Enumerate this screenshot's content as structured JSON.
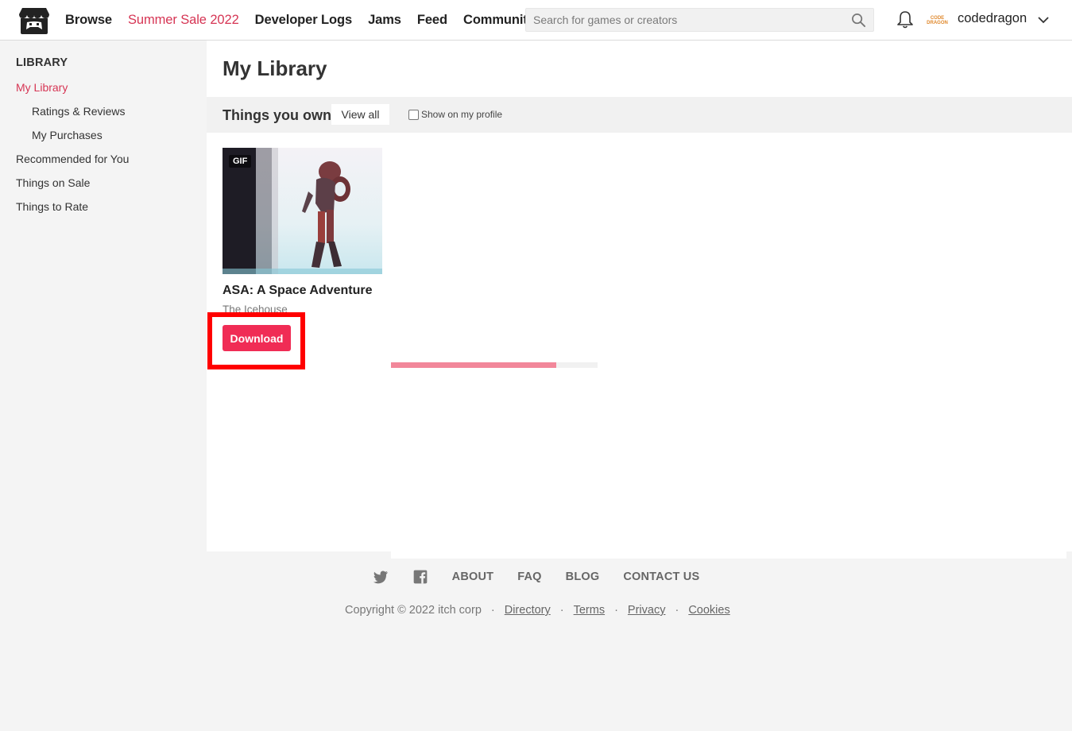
{
  "header": {
    "nav": [
      {
        "label": "Browse"
      },
      {
        "label": "Summer Sale 2022"
      },
      {
        "label": "Developer Logs"
      },
      {
        "label": "Jams"
      },
      {
        "label": "Feed"
      },
      {
        "label": "Community"
      }
    ],
    "search_placeholder": "Search for games or creators",
    "username": "codedragon",
    "avatar_text_top": "CODE",
    "avatar_text_bottom": "DRAGON",
    "accent_color": "#d63554"
  },
  "sidebar": {
    "heading": "LIBRARY",
    "items": [
      {
        "label": "My Library"
      },
      {
        "label": "Ratings & Reviews"
      },
      {
        "label": "My Purchases"
      },
      {
        "label": "Recommended for You"
      },
      {
        "label": "Things on Sale"
      },
      {
        "label": "Things to Rate"
      }
    ]
  },
  "main": {
    "title": "My Library",
    "section": {
      "title": "Things you own",
      "view_all": "View all",
      "show_on_profile": "Show on my profile"
    },
    "game": {
      "badge": "GIF",
      "title": "ASA: A Space Adventure",
      "author": "The Icehouse",
      "download_label": "Download",
      "download_progress": 0.8,
      "button_color": "#f02c55"
    }
  },
  "footer": {
    "links": [
      {
        "label": "ABOUT"
      },
      {
        "label": "FAQ"
      },
      {
        "label": "BLOG"
      },
      {
        "label": "CONTACT US"
      }
    ],
    "copyright": "Copyright © 2022 itch corp",
    "legal": [
      {
        "label": "Directory"
      },
      {
        "label": "Terms"
      },
      {
        "label": "Privacy"
      },
      {
        "label": "Cookies"
      }
    ]
  }
}
